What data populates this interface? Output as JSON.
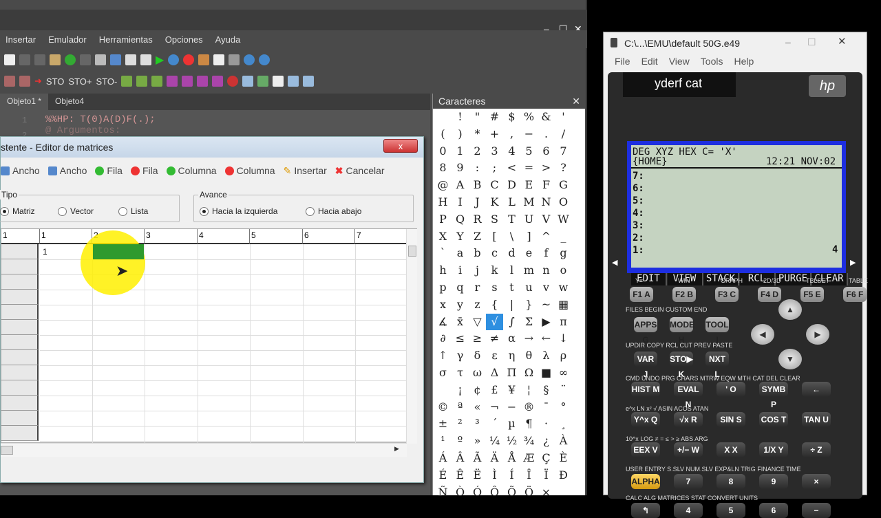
{
  "ide": {
    "menu": [
      "Insertar",
      "Emulador",
      "Herramientas",
      "Opciones",
      "Ayuda"
    ],
    "toolbar2_labels": [
      "STO",
      "STO+",
      "STO-"
    ],
    "tabs": [
      "Objeto1 *",
      "Objeto4"
    ],
    "code_line1": "%%HP: T(0)A(D)F(.);",
    "code_line2": "@ Argumentos:",
    "line_numbers": [
      "1",
      "2"
    ]
  },
  "chars_panel": {
    "title": "Caracteres",
    "chars": [
      "",
      "!",
      "\"",
      "#",
      "$",
      "%",
      "&",
      "'",
      "(",
      ")",
      "*",
      "+",
      ",",
      "−",
      ".",
      "/",
      "0",
      "1",
      "2",
      "3",
      "4",
      "5",
      "6",
      "7",
      "8",
      "9",
      ":",
      ";",
      "<",
      "=",
      ">",
      "?",
      "@",
      "A",
      "B",
      "C",
      "D",
      "E",
      "F",
      "G",
      "H",
      "I",
      "J",
      "K",
      "L",
      "M",
      "N",
      "O",
      "P",
      "Q",
      "R",
      "S",
      "T",
      "U",
      "V",
      "W",
      "X",
      "Y",
      "Z",
      "[",
      "\\",
      "]",
      "^",
      "_",
      "`",
      "a",
      "b",
      "c",
      "d",
      "e",
      "f",
      "g",
      "h",
      "i",
      "j",
      "k",
      "l",
      "m",
      "n",
      "o",
      "p",
      "q",
      "r",
      "s",
      "t",
      "u",
      "v",
      "w",
      "x",
      "y",
      "z",
      "{",
      "|",
      "}",
      "~",
      "▦",
      "∡",
      "x̄",
      "▽",
      "√",
      "∫",
      "Σ",
      "▶",
      "π",
      "∂",
      "≤",
      "≥",
      "≠",
      "α",
      "→",
      "←",
      "↓",
      "↑",
      "γ",
      "δ",
      "ε",
      "η",
      "θ",
      "λ",
      "ρ",
      "σ",
      "τ",
      "ω",
      "Δ",
      "Π",
      "Ω",
      "■",
      "∞",
      "",
      "¡",
      "¢",
      "£",
      "¥",
      "¦",
      "§",
      "¨",
      "©",
      "ª",
      "«",
      "¬",
      "−",
      "®",
      "¯",
      "°",
      "±",
      "²",
      "³",
      "´",
      "µ",
      "¶",
      "·",
      "¸",
      "¹",
      "º",
      "»",
      "¼",
      "½",
      "¾",
      "¿",
      "À",
      "Á",
      "Â",
      "Ã",
      "Ä",
      "Å",
      "Æ",
      "Ç",
      "È",
      "É",
      "Ê",
      "Ë",
      "Ì",
      "Í",
      "Î",
      "Ï",
      "Ð",
      "Ñ",
      "Ò",
      "Ó",
      "Ô",
      "Õ",
      "Ö",
      "×"
    ],
    "selected": "√"
  },
  "dialog": {
    "title": "stente - Editor de matrices",
    "close": "x",
    "toolbar": [
      "Ancho",
      "Ancho",
      "Fila",
      "Fila",
      "Columna",
      "Columna",
      "Insertar",
      "Cancelar"
    ],
    "tipo_label": "Tipo",
    "tipo_options": [
      "Matriz",
      "Vector",
      "Lista"
    ],
    "avance_label": "Avance",
    "avance_options": [
      "Hacia la izquierda",
      "Hacia abajo"
    ],
    "columns": [
      "1",
      "1",
      "2",
      "3",
      "4",
      "5",
      "6",
      "7"
    ],
    "cell_value": "1"
  },
  "calc": {
    "window_title": "C:\\...\\EMU\\default 50G.e49",
    "menu": [
      "File",
      "Edit",
      "View",
      "Tools",
      "Help"
    ],
    "banner": "yderf cat",
    "brand": "hp",
    "status1": "DEG XYZ HEX C= 'X'",
    "status2": "{HOME}",
    "clock": "12:21 NOV:02",
    "stack_levels": [
      "7:",
      "6:",
      "5:",
      "4:",
      "3:",
      "2:",
      "1:"
    ],
    "stack_value": "4",
    "softkeys": [
      "EDIT",
      "VIEW",
      "STACK",
      "RCL",
      "PURGE",
      "CLEAR"
    ],
    "fkey_labels": [
      "Y=",
      "WIN",
      "GRAPH",
      "2D/3D",
      "TBLSET",
      "TABLE"
    ],
    "fkeys": [
      "F1 A",
      "F2 B",
      "F3 C",
      "F4 D",
      "F5 E",
      "F6 F"
    ],
    "row2_label": "FILES BEGIN CUSTOM END",
    "row2_keys": [
      "APPS G",
      "MODE H",
      "TOOL I"
    ],
    "row3_label": "UPDIR COPY RCL CUT PREV PASTE",
    "row3_keys": [
      "VAR J",
      "STO▶ K",
      "NXT L"
    ],
    "row4_label": "CMD UNDO PRG CHARS MTRW EQW MTH CAT DEL CLEAR",
    "row4_keys": [
      "HIST M",
      "EVAL N",
      "' O",
      "SYMB P",
      "←"
    ],
    "row5_label": "e^x LN x² √ ASIN ACOS ATAN",
    "row5_keys": [
      "Y^x Q",
      "√x R",
      "SIN S",
      "COS T",
      "TAN U"
    ],
    "row6_label": "10^x LOG ≠ = ≤ > ≥ ABS ARG",
    "row6_keys": [
      "EEX V",
      "+/− W",
      "X X",
      "1/X Y",
      "÷ Z"
    ],
    "row7_label": "USER ENTRY S.SLV NUM.SLV EXP&LN TRIG FINANCE TIME",
    "row7_keys": [
      "ALPHA",
      "7",
      "8",
      "9",
      "×"
    ],
    "row8_label": "CALC ALG MATRICES STAT CONVERT UNITS",
    "row8_keys": [
      "↰",
      "4",
      "5",
      "6",
      "−"
    ]
  }
}
